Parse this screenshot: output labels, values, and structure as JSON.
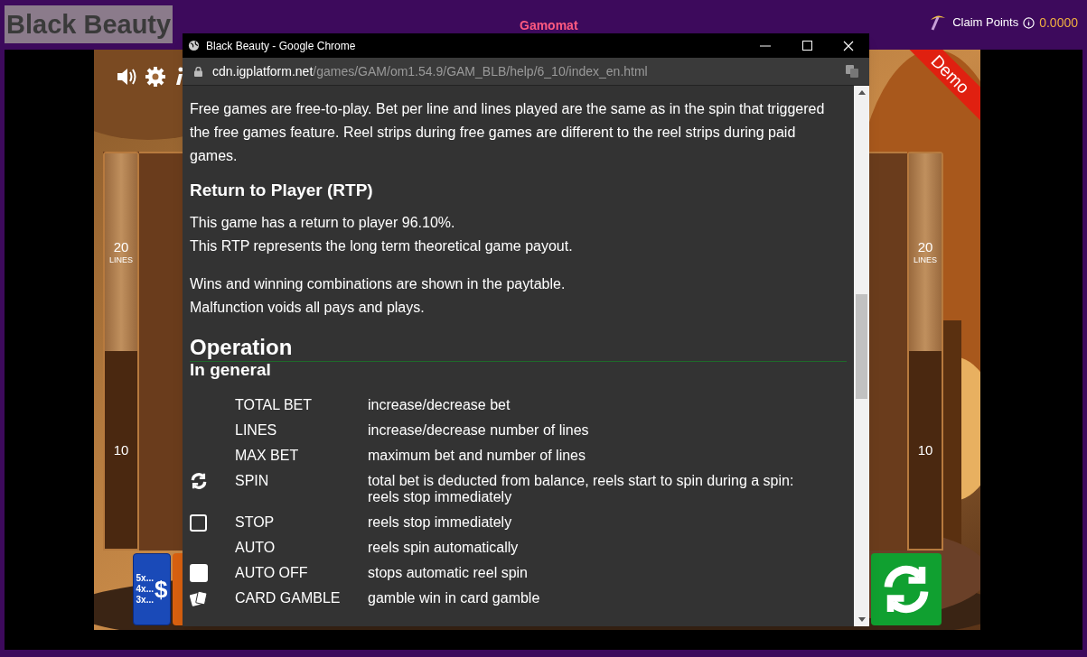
{
  "top_bar": {
    "title": "Black Beauty",
    "provider": "Gamomat",
    "claim_label": "Claim Points",
    "points": "0.0000"
  },
  "game": {
    "badge": "Demo",
    "side_panels": [
      {
        "top_number": "20",
        "top_label": "LINES",
        "bottom_number": "10"
      },
      {
        "top_number": "20",
        "top_label": "LINES",
        "bottom_number": "10"
      }
    ],
    "bet_button": {
      "lines": [
        "5x...",
        "4x...",
        "3x..."
      ],
      "symbol": "$"
    }
  },
  "browser": {
    "title": "Black Beauty - Google Chrome",
    "url_host": "cdn.igplatform.net",
    "url_path": "/games/GAM/om1.54.9/GAM_BLB/help/6_10/index_en.html",
    "content": [
      {
        "kind": "paragraph",
        "lines": [
          "Free games are free-to-play. Bet per line and lines played are the same as in the spin that triggered the free games feature. Reel strips during free games are different to the reel strips during paid games."
        ]
      },
      {
        "kind": "heading",
        "text": "Return to Player (RTP)"
      },
      {
        "kind": "paragraph",
        "lines": [
          "This game has a return to player 96.10%.",
          "This RTP represents the long term theoretical game payout."
        ]
      },
      {
        "kind": "paragraph",
        "lines": [
          "Wins and winning combinations are shown in the paytable.",
          "Malfunction voids all pays and plays."
        ]
      },
      {
        "kind": "section",
        "text": "Operation"
      },
      {
        "kind": "heading",
        "text": "In general"
      },
      {
        "kind": "table",
        "rows": [
          {
            "kind": "plain",
            "name": "TOTAL BET",
            "description": "increase/decrease bet"
          },
          {
            "kind": "plain",
            "name": "LINES",
            "description": "increase/decrease number of lines"
          },
          {
            "kind": "plain",
            "name": "MAX BET",
            "description": "maximum bet and number of lines"
          },
          {
            "kind": "spin",
            "name": "SPIN",
            "description": "total bet is deducted from balance, reels start to spin during a spin: reels stop immediately"
          },
          {
            "kind": "stop",
            "name": "STOP",
            "description": "reels stop immediately"
          },
          {
            "kind": "plain",
            "name": "AUTO",
            "description": "reels spin automatically"
          },
          {
            "kind": "auto-off",
            "name": "AUTO OFF",
            "description": "stops automatic reel spin"
          },
          {
            "kind": "cards",
            "name": "CARD GAMBLE",
            "description": "gamble win in card gamble"
          }
        ]
      }
    ]
  }
}
